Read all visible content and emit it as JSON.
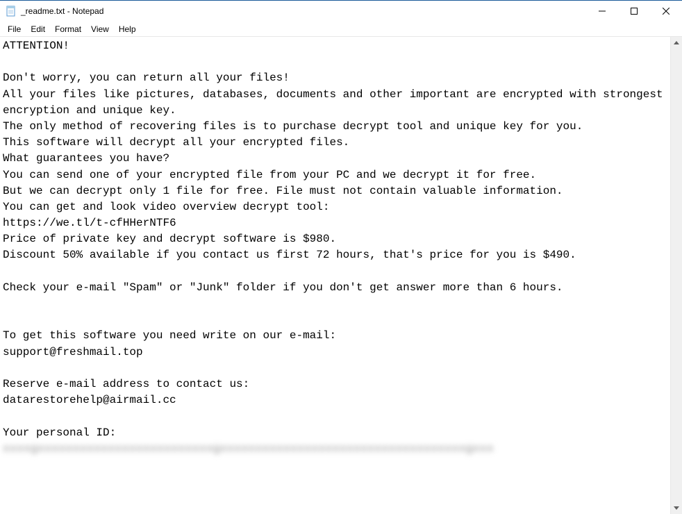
{
  "window": {
    "title": "_readme.txt - Notepad"
  },
  "menu": {
    "file": "File",
    "edit": "Edit",
    "format": "Format",
    "view": "View",
    "help": "Help"
  },
  "content": {
    "line1": "ATTENTION!",
    "line2": "",
    "line3": "Don't worry, you can return all your files!",
    "line4": "All your files like pictures, databases, documents and other important are encrypted with strongest encryption and unique key.",
    "line5": "The only method of recovering files is to purchase decrypt tool and unique key for you.",
    "line6": "This software will decrypt all your encrypted files.",
    "line7": "What guarantees you have?",
    "line8": "You can send one of your encrypted file from your PC and we decrypt it for free.",
    "line9": "But we can decrypt only 1 file for free. File must not contain valuable information.",
    "line10": "You can get and look video overview decrypt tool:",
    "line11": "https://we.tl/t-cfHHerNTF6",
    "line12": "Price of private key and decrypt software is $980.",
    "line13": "Discount 50% available if you contact us first 72 hours, that's price for you is $490.",
    "line14": "",
    "line15": "Check your e-mail \"Spam\" or \"Junk\" folder if you don't get answer more than 6 hours.",
    "line16": "",
    "line17": "",
    "line18": "To get this software you need write on our e-mail:",
    "line19": "support@freshmail.top",
    "line20": "",
    "line21": "Reserve e-mail address to contact us:",
    "line22": "datarestorehelp@airmail.cc",
    "line23": "",
    "line24": "Your personal ID:",
    "line25_blurred": "xxxxgxxxxxxxxxxxxxxxxxxxxxxxxxgxxxxxxxxxxxxxxxxxxxxxxxxxxxxxxxxxxxgxxx"
  }
}
